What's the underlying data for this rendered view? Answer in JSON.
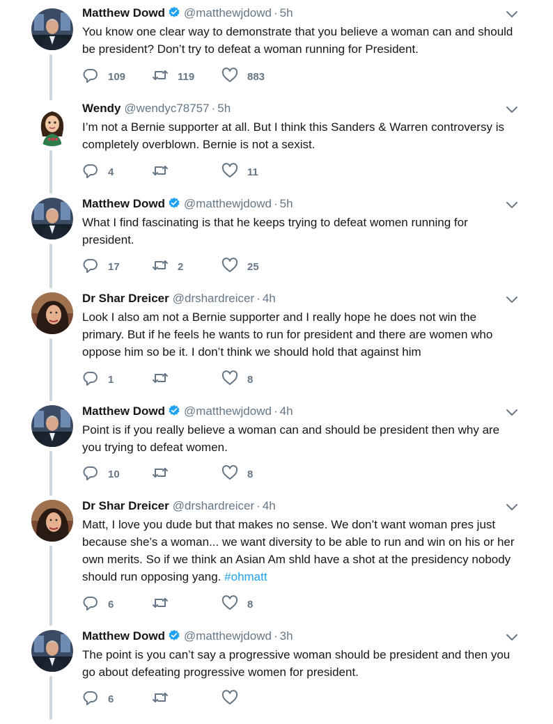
{
  "colors": {
    "accent": "#1da1f2",
    "thread_line": "#ccd6dd",
    "muted": "#657786",
    "text": "#14171a"
  },
  "icons": {
    "reply": "reply-icon",
    "retweet": "retweet-icon",
    "like": "heart-icon",
    "verified": "verified-badge-icon",
    "more": "chevron-down-icon"
  },
  "tweets": [
    {
      "name": "Matthew Dowd",
      "verified": true,
      "handle": "@matthewjdowd",
      "sep": "·",
      "time": "5h",
      "text": "You know one clear way to demonstrate that you believe a woman can and should be president?  Don’t try to defeat a woman running for President.",
      "hashtag": "",
      "replies": "109",
      "retweets": "119",
      "likes": "883"
    },
    {
      "name": "Wendy",
      "verified": false,
      "handle": "@wendyc78757",
      "sep": "·",
      "time": "5h",
      "text": "I’m not a Bernie supporter at all. But I think this Sanders & Warren controversy is completely overblown. Bernie is not a sexist.",
      "hashtag": "",
      "replies": "4",
      "retweets": "",
      "likes": "11"
    },
    {
      "name": "Matthew Dowd",
      "verified": true,
      "handle": "@matthewjdowd",
      "sep": "·",
      "time": "5h",
      "text": "What I find fascinating is that he keeps trying to defeat women running for president.",
      "hashtag": "",
      "replies": "17",
      "retweets": "2",
      "likes": "25"
    },
    {
      "name": "Dr Shar Dreicer",
      "verified": false,
      "handle": "@drshardreicer",
      "sep": "·",
      "time": "4h",
      "text": "Look I also am not a Bernie supporter and I really hope he does not win the primary. But if he feels he wants to run for president and there are women who oppose him so be it. I don’t think we should hold that against him",
      "hashtag": "",
      "replies": "1",
      "retweets": "",
      "likes": "8"
    },
    {
      "name": "Matthew Dowd",
      "verified": true,
      "handle": "@matthewjdowd",
      "sep": "·",
      "time": "4h",
      "text": "Point is if you really believe a woman can and should be president then why are you trying to defeat women.",
      "hashtag": "",
      "replies": "10",
      "retweets": "",
      "likes": "8"
    },
    {
      "name": "Dr Shar Dreicer",
      "verified": false,
      "handle": "@drshardreicer",
      "sep": "·",
      "time": "4h",
      "text": "Matt, I love you dude but that makes no sense. We don’t want woman pres just because she’s a woman... we want diversity to be able to run and win on his or her own merits. So if we think an Asian Am shld have a shot at the presidency nobody should run opposing yang. ",
      "hashtag": "#ohmatt",
      "replies": "6",
      "retweets": "",
      "likes": "8"
    },
    {
      "name": "Matthew Dowd",
      "verified": true,
      "handle": "@matthewjdowd",
      "sep": "·",
      "time": "3h",
      "text": "The point is you can’t say a progressive woman should be president and then you go about defeating progressive women for president.",
      "hashtag": "",
      "replies": "6",
      "retweets": "",
      "likes": ""
    }
  ]
}
